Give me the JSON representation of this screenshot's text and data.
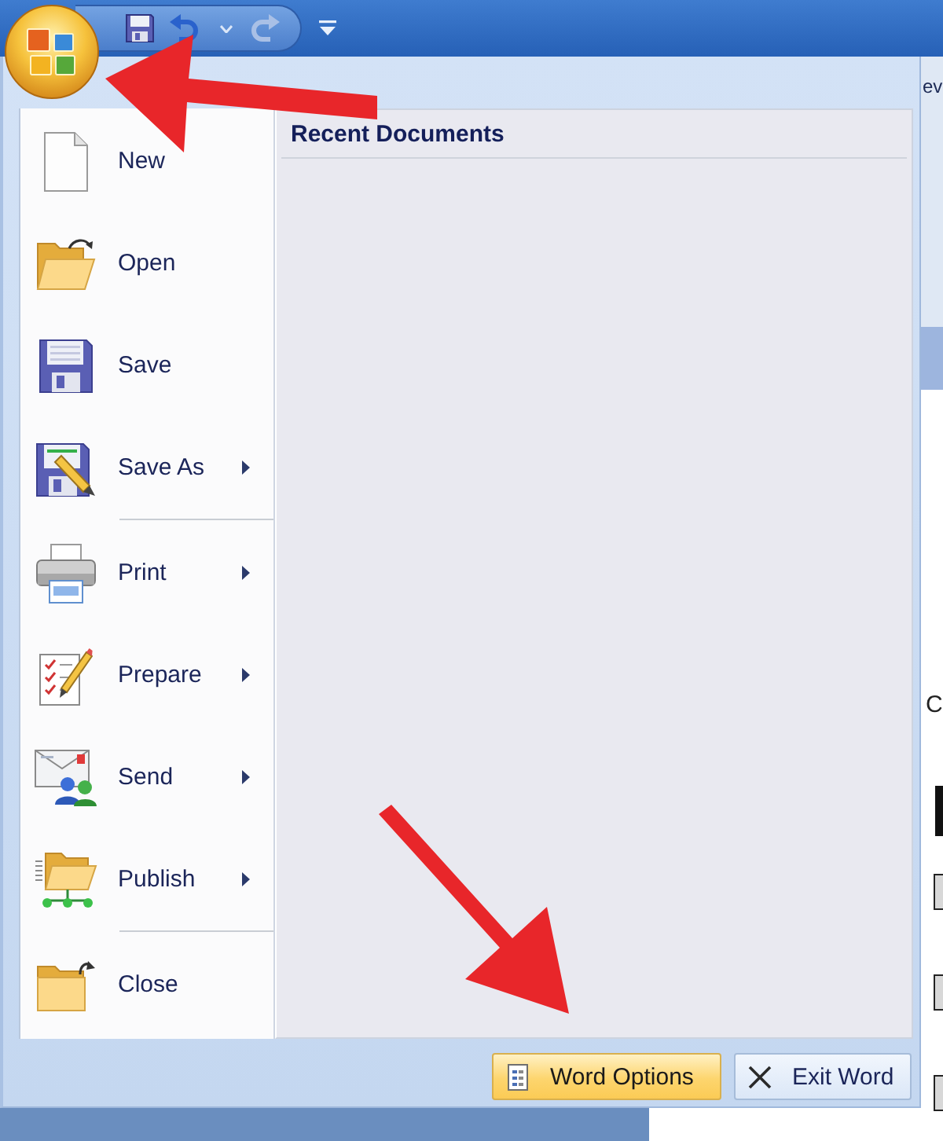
{
  "quick_access_toolbar": {
    "redo": {
      "disabled": true
    }
  },
  "ribbon_tab_partial": "ev",
  "office_menu": {
    "items": [
      {
        "kind": "new",
        "label": "New",
        "submenu": false,
        "separator_after": false
      },
      {
        "kind": "open",
        "label": "Open",
        "submenu": false,
        "separator_after": false
      },
      {
        "kind": "save",
        "label": "Save",
        "submenu": false,
        "separator_after": false
      },
      {
        "kind": "saveas",
        "label": "Save As",
        "submenu": true,
        "separator_after": true
      },
      {
        "kind": "print",
        "label": "Print",
        "submenu": true,
        "separator_after": false
      },
      {
        "kind": "prepare",
        "label": "Prepare",
        "submenu": true,
        "separator_after": false
      },
      {
        "kind": "send",
        "label": "Send",
        "submenu": true,
        "separator_after": false
      },
      {
        "kind": "publish",
        "label": "Publish",
        "submenu": true,
        "separator_after": true
      },
      {
        "kind": "close",
        "label": "Close",
        "submenu": false,
        "separator_after": false
      }
    ],
    "recent_documents": {
      "title": "Recent Documents"
    },
    "footer_buttons": [
      {
        "kind": "options",
        "label": "Word Options",
        "highlighted": true
      },
      {
        "kind": "exit",
        "label": "Exit Word",
        "highlighted": false
      }
    ]
  },
  "background_document": {
    "partial_text": "C"
  }
}
